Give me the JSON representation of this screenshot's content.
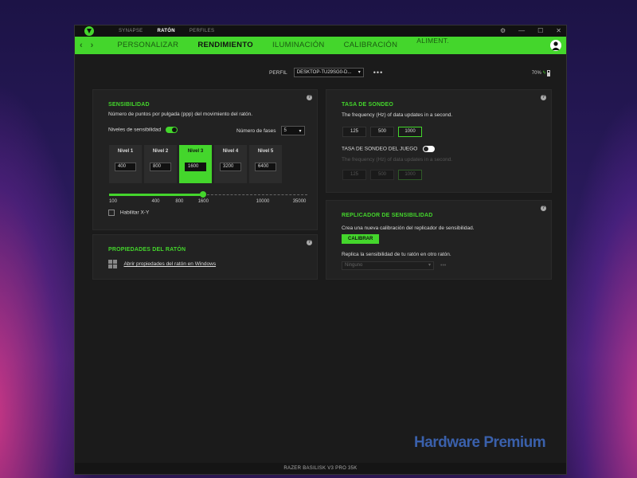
{
  "titlebar": {
    "tabs": [
      {
        "label": "SYNAPSE",
        "active": false
      },
      {
        "label": "RATÓN",
        "active": true
      },
      {
        "label": "PERFILES",
        "active": false
      }
    ],
    "controls": [
      "⚙",
      "—",
      "☐",
      "✕"
    ]
  },
  "navbar": {
    "tabs": [
      {
        "label": "PERSONALIZAR",
        "active": false
      },
      {
        "label": "RENDIMIENTO",
        "active": true
      },
      {
        "label": "ILUMINACIÓN",
        "active": false
      },
      {
        "label": "CALIBRACIÓN",
        "active": false
      },
      {
        "label": "ALIMENT.",
        "active": false
      }
    ]
  },
  "profile": {
    "label": "PERFIL",
    "value": "DESKTOP-TU29SG0-D...",
    "more": "•••"
  },
  "battery": {
    "text": "70%",
    "level": 0.7
  },
  "sensitivity": {
    "title": "SENSIBILIDAD",
    "description": "Número de puntos por pulgada (ppp) del movimiento del ratón.",
    "levels_toggle_label": "Niveles de sensibilidad",
    "levels_toggle_on": true,
    "phases_label": "Número de fases",
    "phases_value": "5",
    "levels": [
      {
        "label": "Nivel 1",
        "value": "400",
        "active": false
      },
      {
        "label": "Nivel 2",
        "value": "800",
        "active": false
      },
      {
        "label": "Nivel 3",
        "value": "1600",
        "active": true
      },
      {
        "label": "Nivel 4",
        "value": "3200",
        "active": false
      },
      {
        "label": "Nivel 5",
        "value": "6400",
        "active": false
      }
    ],
    "slider_fraction": 0.475,
    "ticks": [
      "100",
      "400",
      "800",
      "1600",
      "10000",
      "35000"
    ],
    "xy_label": "Habilitar X-Y"
  },
  "mouse_props": {
    "title": "PROPIEDADES DEL RATÓN",
    "link": "Abrir propiedades del ratón en Windows"
  },
  "polling": {
    "title": "TASA DE SONDEO",
    "description": "The frequency (Hz) of data updates in a second.",
    "options": [
      "125",
      "500",
      "1000"
    ],
    "selected": "1000",
    "game_title": "TASA DE SONDEO DEL JUEGO",
    "game_toggle_on": false,
    "game_description": "The frequency (Hz) of data updates in a second.",
    "game_options": [
      "125",
      "500",
      "1000"
    ]
  },
  "replicator": {
    "title": "REPLICADOR DE SENSIBILIDAD",
    "description": "Crea una nueva calibración del replicador de sensibilidad.",
    "button": "CALIBRAR",
    "replicate_text": "Replica la sensibilidad de tu ratón en otro ratón.",
    "select_value": "Ninguno",
    "more": "•••"
  },
  "statusbar": {
    "device": "RAZER BASILISK V3 PRO 35K"
  },
  "watermark": "Hardware Premium"
}
